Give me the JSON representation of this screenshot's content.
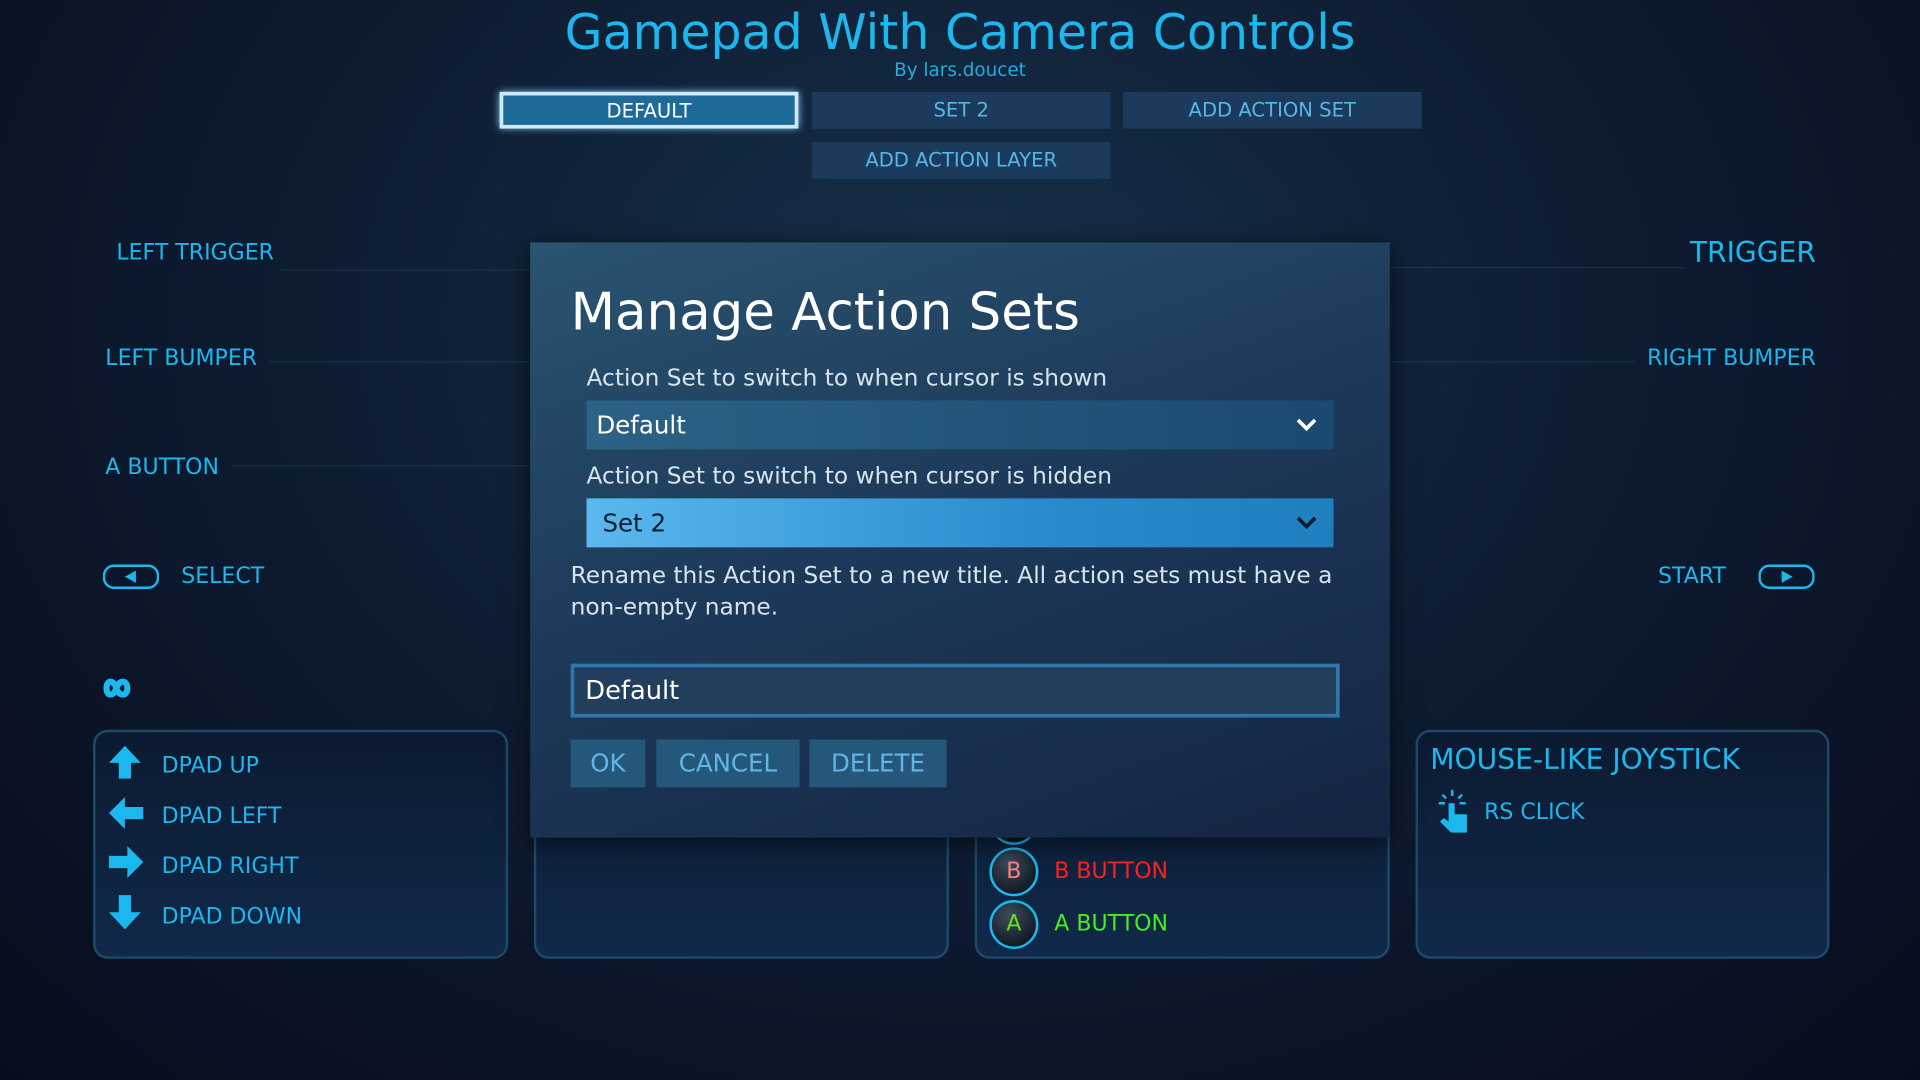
{
  "header": {
    "title": "Gamepad With Camera Controls",
    "byline": "By lars.doucet"
  },
  "tabs": [
    {
      "label": "DEFAULT",
      "selected": true
    },
    {
      "label": "SET 2"
    },
    {
      "label": "ADD ACTION SET"
    },
    {
      "label": "ADD ACTION LAYER"
    }
  ],
  "left": {
    "trigger": "LEFT TRIGGER",
    "bumper": "LEFT BUMPER",
    "a_button": "A BUTTON",
    "select": "SELECT"
  },
  "right": {
    "trigger": "TRIGGER",
    "bumper": "RIGHT BUMPER",
    "start": "START"
  },
  "dpad": {
    "items": [
      "DPAD UP",
      "DPAD LEFT",
      "DPAD RIGHT",
      "DPAD DOWN"
    ]
  },
  "face_buttons": {
    "b": {
      "glyph": "B",
      "label": "B BUTTON",
      "color": "#ff2020"
    },
    "a": {
      "glyph": "A",
      "label": "A BUTTON",
      "color": "#44ee22"
    }
  },
  "joystick": {
    "title": "MOUSE-LIKE JOYSTICK",
    "rs_click": "RS CLICK"
  },
  "modal": {
    "title": "Manage Action Sets",
    "shown_label": "Action Set to switch to when cursor is shown",
    "shown_value": "Default",
    "hidden_label": "Action Set to switch to when cursor is hidden",
    "hidden_value": "Set 2",
    "rename_text": "Rename this Action Set to a new title. All action sets must have a non-empty name.",
    "name_value": "Default",
    "ok": "OK",
    "cancel": "CANCEL",
    "delete": "DELETE"
  },
  "colors": {
    "accent": "#1ab8ee",
    "background": "#0e1d33"
  }
}
